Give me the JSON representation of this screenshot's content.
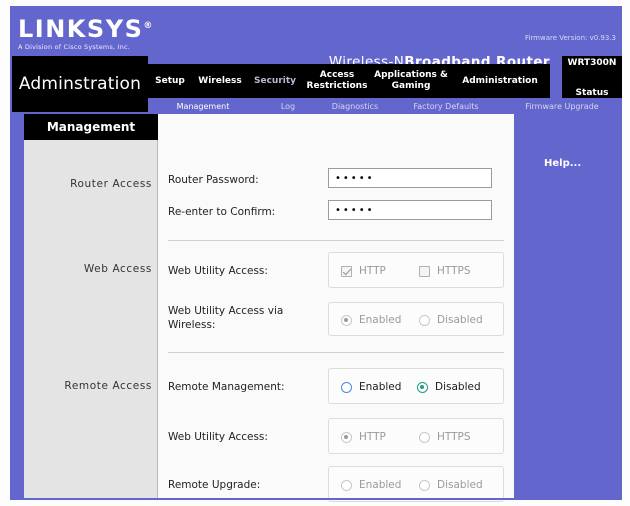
{
  "brand": {
    "name": "LINKSYS",
    "registered": "®",
    "tagline": "A Division of Cisco Systems, Inc.",
    "firmware": "Firmware Version: v0.93.3"
  },
  "header": {
    "product_title_thin": "Wireless-N",
    "product_title_bold": "Broadband Router",
    "model": "WRT300N",
    "section_name": "Adminstration"
  },
  "tabs": [
    {
      "label": "Setup",
      "active": false
    },
    {
      "label": "Wireless",
      "active": false
    },
    {
      "label": "Security",
      "active": false
    },
    {
      "label": "Access Restrictions",
      "active": false
    },
    {
      "label": "Applications & Gaming",
      "active": false
    },
    {
      "label": "Administration",
      "active": true
    },
    {
      "label": "Status",
      "active": false
    }
  ],
  "subtabs": [
    {
      "label": "Management",
      "active": true
    },
    {
      "label": "Log",
      "active": false
    },
    {
      "label": "Diagnostics",
      "active": false
    },
    {
      "label": "Factory Defaults",
      "active": false
    },
    {
      "label": "Firmware Upgrade",
      "active": false
    }
  ],
  "page": {
    "title": "Management",
    "help_label": "Help..."
  },
  "sidebar": {
    "sections": [
      {
        "label": "Router Access"
      },
      {
        "label": "Web Access"
      },
      {
        "label": "Remote Access"
      }
    ]
  },
  "form": {
    "router_password": {
      "label": "Router Password:",
      "value": "•••••"
    },
    "confirm_password": {
      "label": "Re-enter to Confirm:",
      "value": "•••••"
    },
    "web_utility_access": {
      "label": "Web Utility Access:",
      "http": "HTTP",
      "https": "HTTPS"
    },
    "web_utility_wireless": {
      "label": "Web Utility Access via Wireless:",
      "enabled": "Enabled",
      "disabled": "Disabled"
    },
    "remote_management": {
      "label": "Remote Management:",
      "enabled": "Enabled",
      "disabled": "Disabled"
    },
    "remote_web_utility_access": {
      "label": "Web Utility Access:",
      "http": "HTTP",
      "https": "HTTPS"
    },
    "remote_upgrade": {
      "label": "Remote Upgrade:",
      "enabled": "Enabled",
      "disabled": "Disabled"
    }
  }
}
